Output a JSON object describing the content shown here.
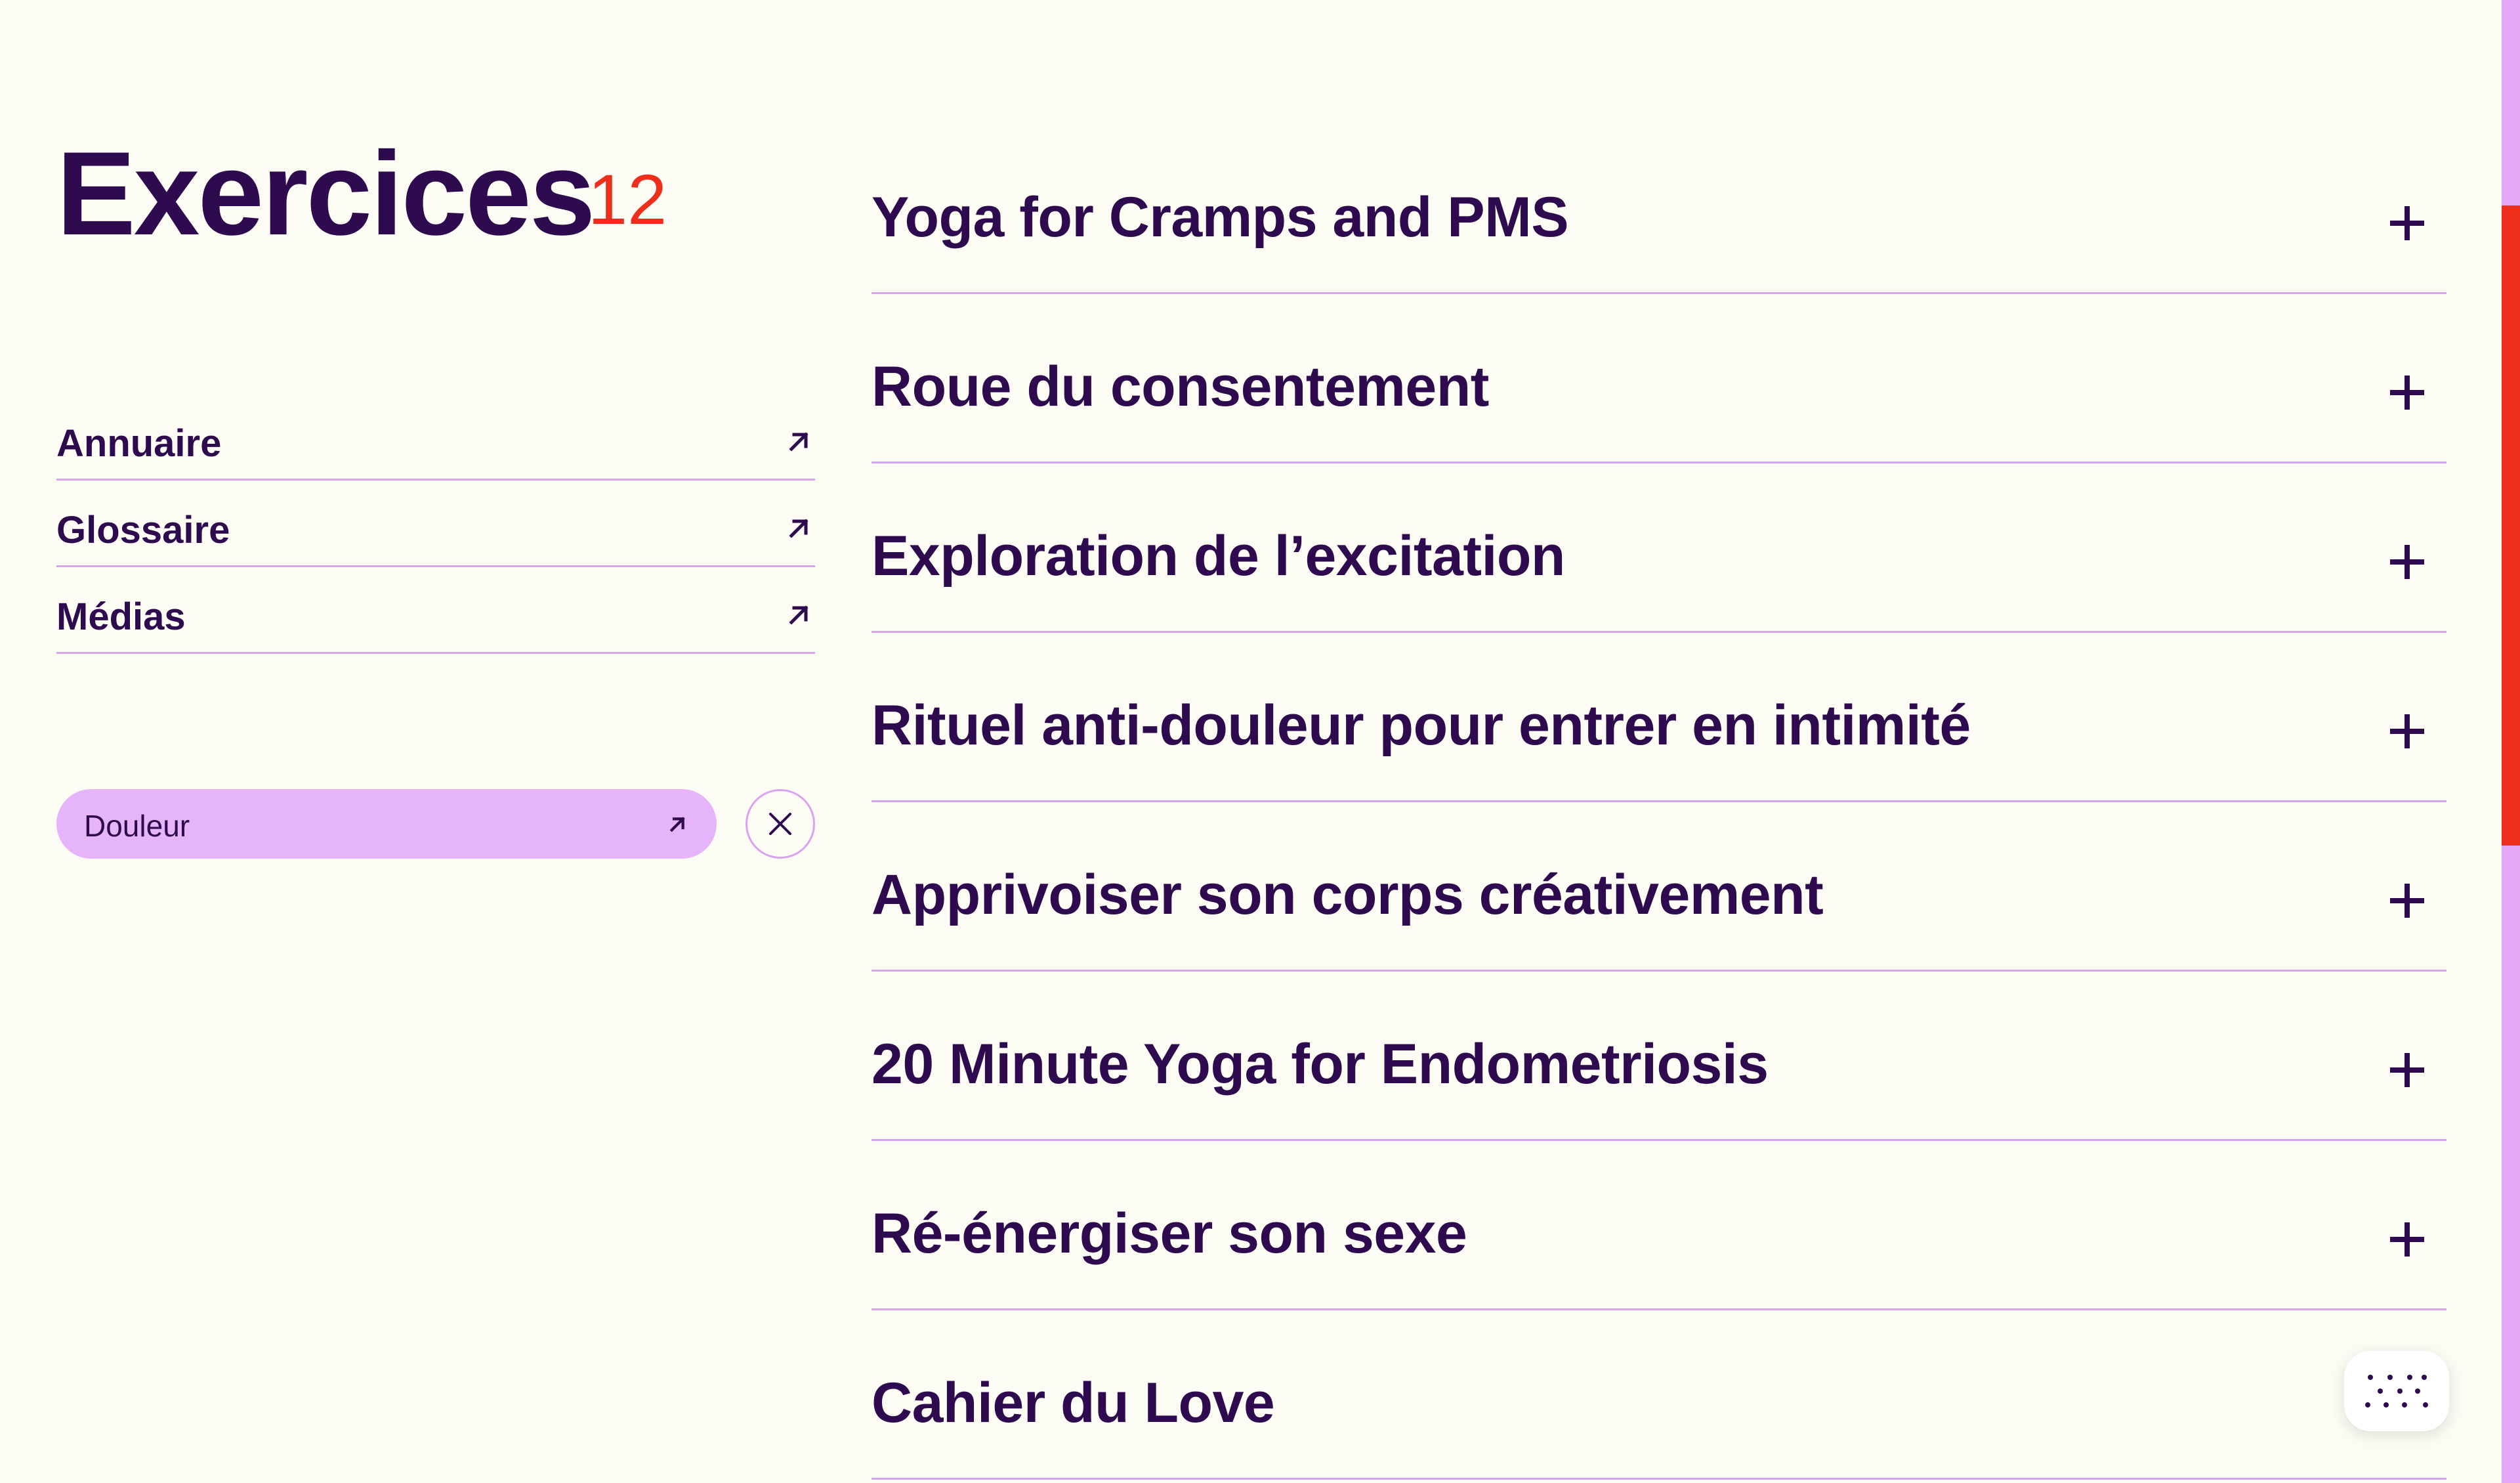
{
  "header": {
    "title": "Exercices",
    "count": "12"
  },
  "sidebar": {
    "links": [
      {
        "label": "Annuaire",
        "icon": "arrow-up-right-icon"
      },
      {
        "label": "Glossaire",
        "icon": "arrow-up-right-icon"
      },
      {
        "label": "Médias",
        "icon": "arrow-up-right-icon"
      }
    ],
    "filter": {
      "label": "Douleur",
      "icon": "arrow-up-right-icon",
      "clear_icon": "close-icon"
    }
  },
  "exercises": [
    {
      "title": "Yoga for Cramps and PMS",
      "icon": "plus-icon"
    },
    {
      "title": "Roue du consentement",
      "icon": "plus-icon"
    },
    {
      "title": "Exploration de l’excitation",
      "icon": "plus-icon"
    },
    {
      "title": "Rituel anti-douleur pour entrer en intimité",
      "icon": "plus-icon"
    },
    {
      "title": "Apprivoiser son corps créativement",
      "icon": "plus-icon"
    },
    {
      "title": "20 Minute Yoga for Endometriosis",
      "icon": "plus-icon"
    },
    {
      "title": "Ré-énergiser son sexe",
      "icon": "plus-icon"
    },
    {
      "title": "Cahier du Love",
      "icon": "plus-icon"
    }
  ],
  "widget": {
    "icon": "dots-pattern-icon"
  },
  "colors": {
    "background": "#fcfcf4",
    "text": "#2e0a4e",
    "accent": "#ee2e1c",
    "lilac": "#e6b4fb",
    "divider": "#d9a3f0"
  }
}
